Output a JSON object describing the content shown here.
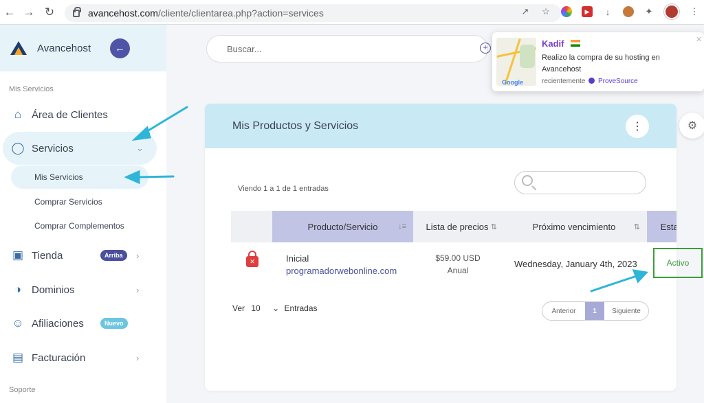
{
  "browser": {
    "url_host": "avancehost.com",
    "url_path": "/cliente/clientarea.php?action=services"
  },
  "sidebar": {
    "brand": "Avancehost",
    "section_services": "Mis Servicios",
    "items": [
      {
        "label": "Área de Clientes"
      },
      {
        "label": "Servicios"
      },
      {
        "label": "Tienda",
        "badge": "Arriba"
      },
      {
        "label": "Dominios"
      },
      {
        "label": "Afiliaciones",
        "badge": "Nuevo"
      },
      {
        "label": "Facturación"
      }
    ],
    "sub_items": [
      {
        "label": "Mis Servicios"
      },
      {
        "label": "Comprar Servicios"
      },
      {
        "label": "Comprar Complementos"
      }
    ],
    "section_support": "Soporte"
  },
  "search": {
    "placeholder": "Buscar..."
  },
  "card": {
    "title": "Mis Productos y Servicios",
    "entries_info": "Viendo 1 a 1 de 1 entradas",
    "columns": [
      "Producto/Servicio",
      "Lista de precios",
      "Próximo vencimiento",
      "Estado"
    ],
    "row": {
      "product_name": "Inicial",
      "domain": "programadorwebonline.com",
      "price": "$59.00 USD",
      "cycle": "Anual",
      "due": "Wednesday, January 4th, 2023",
      "status": "Activo"
    },
    "per_page_label": "Ver",
    "per_page_value": "10",
    "per_page_suffix": "Entradas",
    "pager_prev": "Anterior",
    "pager_current": "1",
    "pager_next": "Siguiente"
  },
  "notification": {
    "name": "Kadif",
    "message": "Realizo la compra de su hosting en Avancehost",
    "time": "recientemente",
    "source": "ProveSource",
    "map_label": "Google"
  },
  "colors": {
    "accent": "#5054a6",
    "light_blue": "#c9e9f4",
    "status_green": "#3a9d3a",
    "annotation": "#2fb5d8"
  }
}
